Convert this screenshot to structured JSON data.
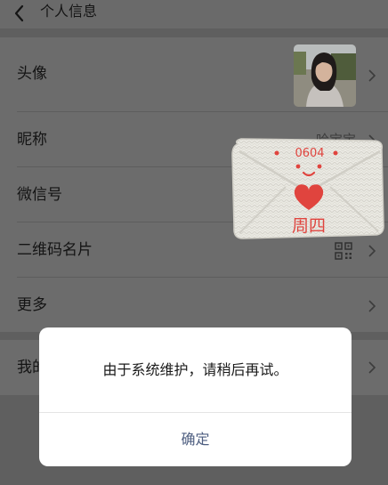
{
  "header": {
    "title": "个人信息",
    "back_icon": "chevron-left-icon"
  },
  "profile": {
    "rows": [
      {
        "label": "头像",
        "type": "avatar"
      },
      {
        "label": "昵称",
        "value": "哈宝宝"
      },
      {
        "label": "微信号",
        "value": ""
      },
      {
        "label": "二维码名片",
        "icon": "qr-code-icon"
      },
      {
        "label": "更多"
      }
    ]
  },
  "secondary": {
    "rows": [
      {
        "label": "我的地址"
      }
    ]
  },
  "sticker": {
    "date_text": "0604",
    "stamp_text": "周四",
    "icon": "envelope-heart-sticker"
  },
  "dialog": {
    "message": "由于系统维护，请稍后再试。",
    "confirm_label": "确定"
  },
  "colors": {
    "overlay_bg": "#5f5f5f",
    "dialog_bg": "#ffffff",
    "confirm_text": "#4e5e80",
    "sticker_red": "#e0443e"
  }
}
